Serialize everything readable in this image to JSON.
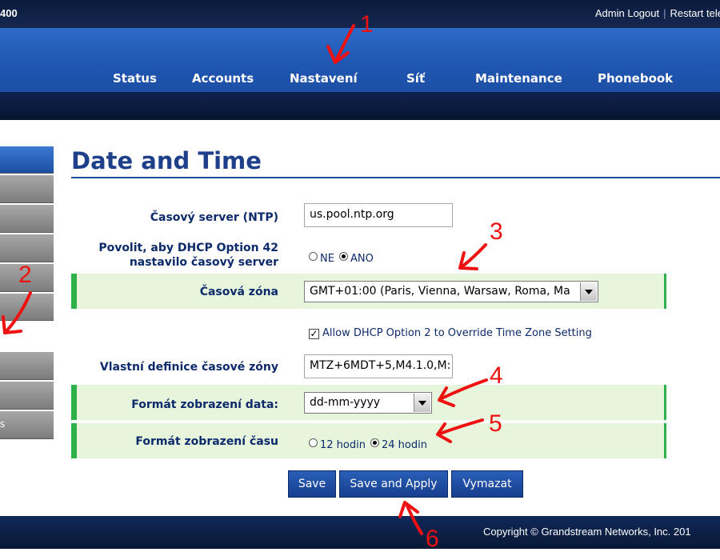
{
  "header": {
    "model": "400",
    "links": [
      "Admin Logout",
      "Restart tele"
    ]
  },
  "nav": [
    "Status",
    "Accounts",
    "Nastavení",
    "Síť",
    "Maintenance",
    "Phonebook"
  ],
  "sidebar": {
    "partial_label": "s"
  },
  "page_title": "Date and Time",
  "form": {
    "ntp": {
      "label": "Časový server (NTP)",
      "value": "us.pool.ntp.org"
    },
    "dhcp42": {
      "label_line1": "Povolit, aby DHCP Option 42",
      "label_line2": "nastavilo časový server",
      "options": [
        "NE",
        "ANO"
      ],
      "selected": "ANO"
    },
    "timezone": {
      "label": "Časová zóna",
      "value": "GMT+01:00 (Paris, Vienna, Warsaw, Roma, Ma"
    },
    "dhcp2": {
      "label": "Allow DHCP Option 2 to Override Time Zone Setting",
      "checked": true
    },
    "custom_tz": {
      "label": "Vlastní definice časové zóny",
      "value": "MTZ+6MDT+5,M4.1.0,M:"
    },
    "date_format": {
      "label": "Formát zobrazení data:",
      "value": "dd-mm-yyyy"
    },
    "time_format": {
      "label": "Formát zobrazení času",
      "options": [
        "12 hodin",
        "24 hodin"
      ],
      "selected": "24 hodin"
    }
  },
  "buttons": {
    "save": "Save",
    "save_apply": "Save and Apply",
    "reset": "Vymazat"
  },
  "footer": {
    "copyright": "Copyright © Grandstream Networks, Inc. 201"
  },
  "annotations": [
    "1",
    "2",
    "3",
    "4",
    "5",
    "6"
  ],
  "colors": {
    "annotation": "#ee1111",
    "nav_blue": "#1f57b3",
    "title_blue": "#1e3f8a",
    "highlight_green": "#2fb14a"
  }
}
